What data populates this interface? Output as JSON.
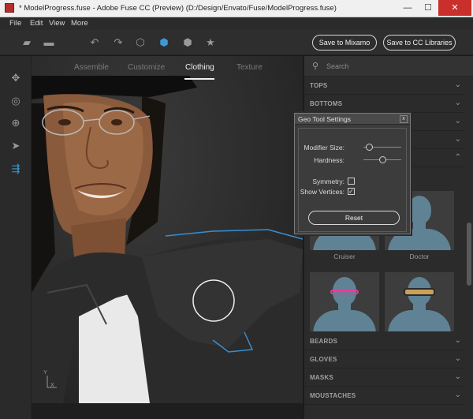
{
  "window": {
    "title": "* ModelProgress.fuse - Adobe Fuse CC (Preview) (D:/Design/Envato/Fuse/ModelProgress.fuse)",
    "minimize": "—",
    "maximize": "☐",
    "close": "✕"
  },
  "menu": {
    "file": "File",
    "edit": "Edit",
    "view": "View",
    "more": "More"
  },
  "toolbar": {
    "save_mixamo": "Save to Mixamo",
    "save_cc": "Save to CC Libraries",
    "icons": [
      "import-icon",
      "open-folder-icon",
      "undo-icon",
      "redo-icon",
      "cube-outline-icon",
      "cube-solid-icon",
      "cube-shaded-icon",
      "star-icon"
    ]
  },
  "leftbar": {
    "icons": [
      "move-icon",
      "camera-icon",
      "target-icon",
      "pointer-icon",
      "geo-tool-icon"
    ],
    "active": "geo-tool-icon"
  },
  "tabs": {
    "assemble": "Assemble",
    "customize": "Customize",
    "clothing": "Clothing",
    "texture": "Texture",
    "active": "Clothing"
  },
  "viewport": {
    "axis_y": "Y",
    "axis_x": "X"
  },
  "search": {
    "placeholder": "Search"
  },
  "categories_top": [
    "TOPS",
    "BOTTOMS",
    "",
    "",
    ""
  ],
  "thumbnails": [
    {
      "label": "Cruiser"
    },
    {
      "label": "Doctor"
    },
    {
      "label": ""
    },
    {
      "label": ""
    }
  ],
  "categories_bottom": [
    "BEARDS",
    "GLOVES",
    "MASKS",
    "MOUSTACHES"
  ],
  "geo_tool": {
    "title": "Geo Tool Settings",
    "close": "x",
    "modifier_size_label": "Modifier Size:",
    "hardness_label": "Hardness:",
    "symmetry_label": "Symmetry:",
    "show_vertices_label": "Show Vertices:",
    "modifier_size_value": 0.15,
    "hardness_value": 0.5,
    "symmetry_checked": false,
    "show_vertices_checked": true,
    "reset_label": "Reset"
  },
  "colors": {
    "accent": "#3a9ad9",
    "glow": "#4aa3e0",
    "avatar": "#5f8394"
  }
}
